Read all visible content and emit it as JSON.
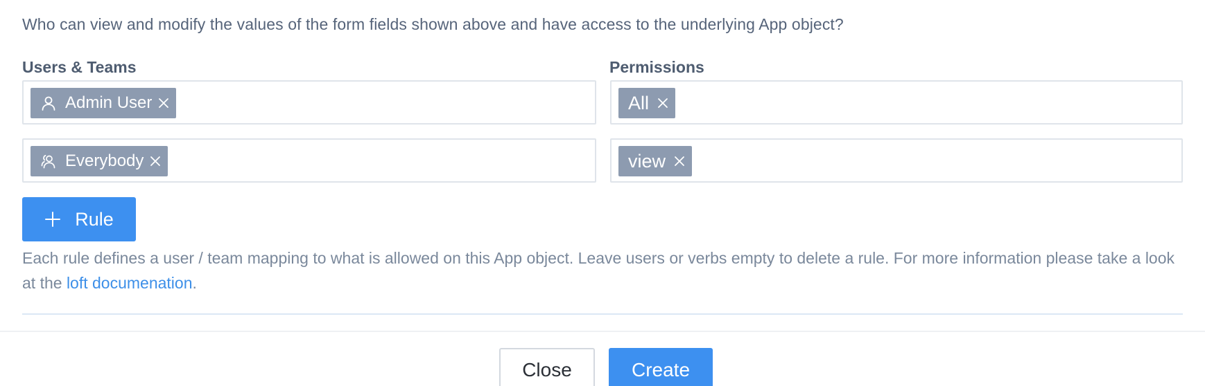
{
  "question": "Who can view and modify the values of the form fields shown above and have access to the underlying App object?",
  "labels": {
    "users_teams": "Users & Teams",
    "permissions": "Permissions"
  },
  "rules": [
    {
      "subject": {
        "name": "Admin User",
        "icon": "user-icon"
      },
      "permission": "All"
    },
    {
      "subject": {
        "name": "Everybody",
        "icon": "team-icon"
      },
      "permission": "view"
    }
  ],
  "rule_button": {
    "label": "Rule",
    "icon": "plus-icon"
  },
  "help": {
    "text_before": "Each rule defines a user / team mapping to what is allowed on this App object. Leave users or verbs empty to delete a rule. For more information please take a look at the ",
    "link_text": "loft documenation",
    "text_after": "."
  },
  "footer": {
    "close_label": "Close",
    "create_label": "Create"
  },
  "colors": {
    "accent": "#3d90f0",
    "chip": "#8d9bb0",
    "link": "#3d8fe8"
  }
}
